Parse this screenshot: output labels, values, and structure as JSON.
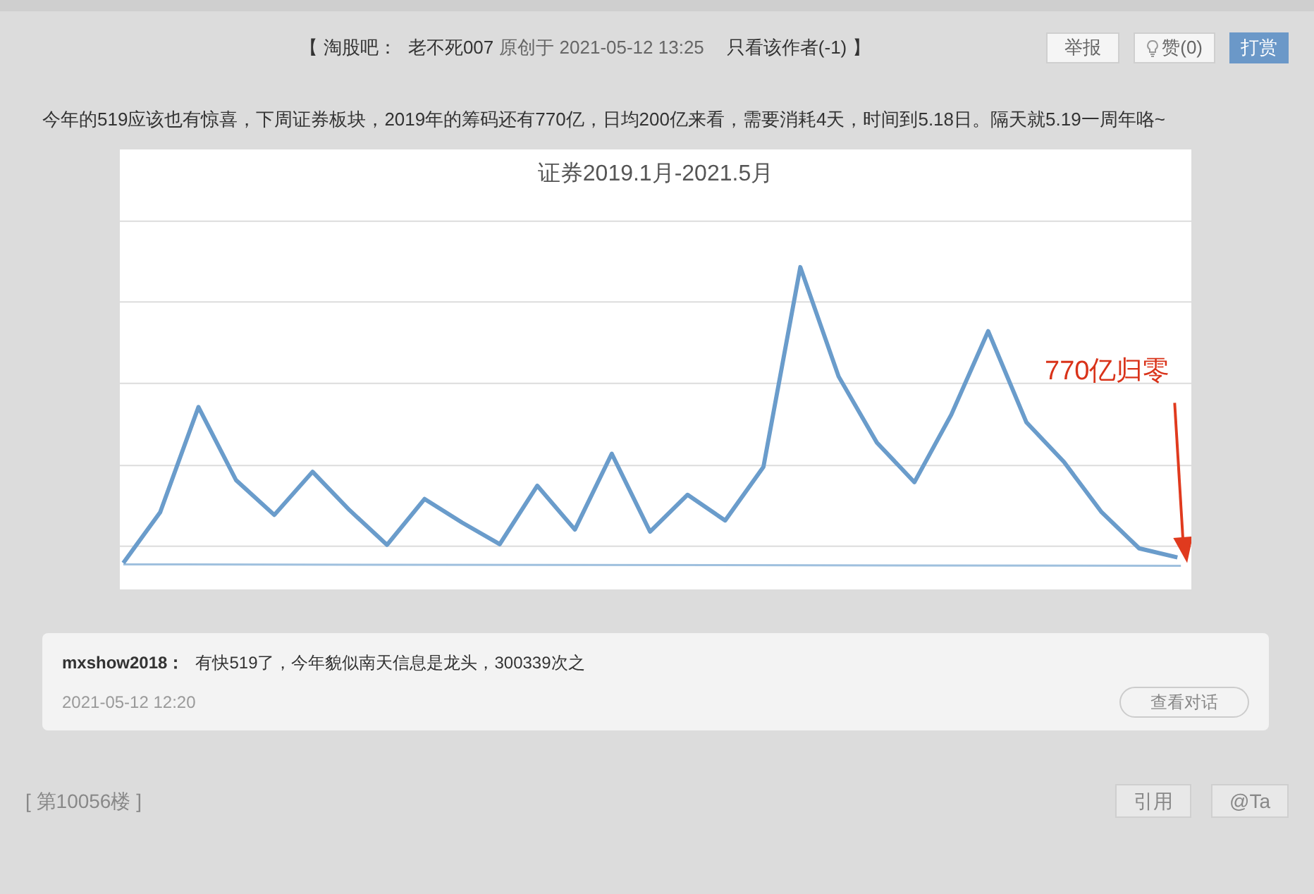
{
  "header": {
    "open_bracket": "【",
    "forum": "淘股吧：",
    "author": "老不死007",
    "created": "原创于 2021-05-12 13:25",
    "only_author": "只看该作者(-1)",
    "close_bracket": "】"
  },
  "actions": [
    {
      "kind": "plain",
      "label": "举报"
    },
    {
      "kind": "like",
      "label": "赞(0)"
    },
    {
      "kind": "primary",
      "label": "打赏"
    }
  ],
  "body": "今年的519应该也有惊喜，下周证券板块，2019年的筹码还有770亿，日均200亿来看，需要消耗4天，时间到5.18日。隔天就5.19一周年咯~",
  "chart": {
    "title": "证券2019.1月-2021.5月",
    "annotation": "770亿归零"
  },
  "reply": {
    "user": "mxshow2018：",
    "text": "有快519了，今年貌似南天信息是龙头，300339次之",
    "time": "2021-05-12 12:20",
    "button": "查看对话"
  },
  "floor": "[ 第10056楼 ]",
  "footer_buttons": [
    "引用",
    "@Ta"
  ]
}
